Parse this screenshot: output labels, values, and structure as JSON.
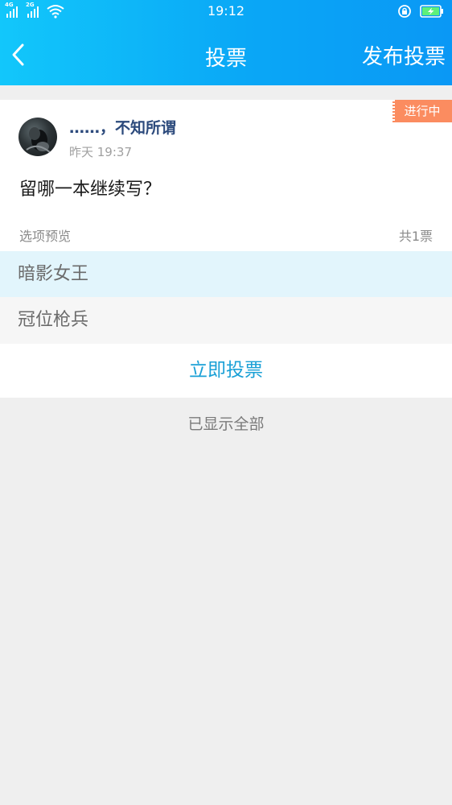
{
  "status_bar": {
    "signal_1_label": "4G",
    "signal_2_label": "2G",
    "time": "19:12",
    "icons": [
      "signal-icon",
      "wifi-icon",
      "rotation-lock-icon",
      "battery-charging-icon"
    ]
  },
  "navbar": {
    "back_icon": "chevron-left-icon",
    "title": "投票",
    "publish_label": "发布投票"
  },
  "poll": {
    "status_tag": "进行中",
    "username": "……，不知所谓",
    "time": "昨天 19:37",
    "question": "留哪一本继续写？",
    "preview_label": "选项预览",
    "vote_count": "共1票",
    "options": [
      {
        "label": "暗影女王"
      },
      {
        "label": "冠位枪兵"
      }
    ],
    "vote_button_label": "立即投票"
  },
  "footer": {
    "text": "已显示全部"
  },
  "colors": {
    "header_gradient_start": "#12c7fb",
    "header_gradient_end": "#0a98f5",
    "tag_background": "#fb8c60",
    "username_color": "#2c4a7c",
    "vote_button_color": "#1aa0d6",
    "selected_option_bg": "#e2f5fc"
  }
}
